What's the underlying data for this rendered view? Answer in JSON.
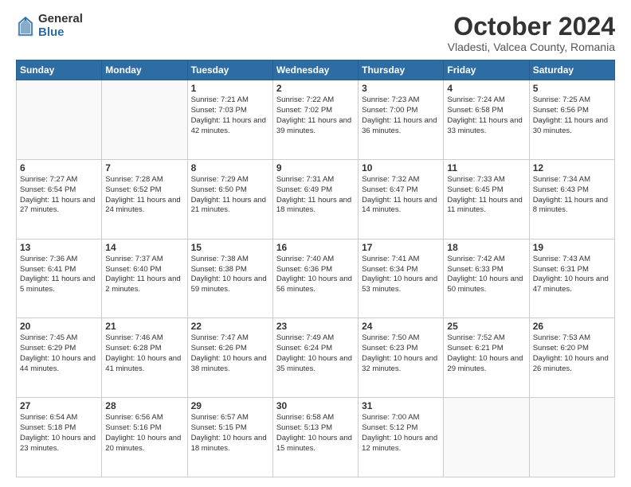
{
  "logo": {
    "general": "General",
    "blue": "Blue"
  },
  "header": {
    "month": "October 2024",
    "location": "Vladesti, Valcea County, Romania"
  },
  "weekdays": [
    "Sunday",
    "Monday",
    "Tuesday",
    "Wednesday",
    "Thursday",
    "Friday",
    "Saturday"
  ],
  "weeks": [
    [
      {
        "day": "",
        "info": ""
      },
      {
        "day": "",
        "info": ""
      },
      {
        "day": "1",
        "info": "Sunrise: 7:21 AM\nSunset: 7:03 PM\nDaylight: 11 hours and 42 minutes."
      },
      {
        "day": "2",
        "info": "Sunrise: 7:22 AM\nSunset: 7:02 PM\nDaylight: 11 hours and 39 minutes."
      },
      {
        "day": "3",
        "info": "Sunrise: 7:23 AM\nSunset: 7:00 PM\nDaylight: 11 hours and 36 minutes."
      },
      {
        "day": "4",
        "info": "Sunrise: 7:24 AM\nSunset: 6:58 PM\nDaylight: 11 hours and 33 minutes."
      },
      {
        "day": "5",
        "info": "Sunrise: 7:25 AM\nSunset: 6:56 PM\nDaylight: 11 hours and 30 minutes."
      }
    ],
    [
      {
        "day": "6",
        "info": "Sunrise: 7:27 AM\nSunset: 6:54 PM\nDaylight: 11 hours and 27 minutes."
      },
      {
        "day": "7",
        "info": "Sunrise: 7:28 AM\nSunset: 6:52 PM\nDaylight: 11 hours and 24 minutes."
      },
      {
        "day": "8",
        "info": "Sunrise: 7:29 AM\nSunset: 6:50 PM\nDaylight: 11 hours and 21 minutes."
      },
      {
        "day": "9",
        "info": "Sunrise: 7:31 AM\nSunset: 6:49 PM\nDaylight: 11 hours and 18 minutes."
      },
      {
        "day": "10",
        "info": "Sunrise: 7:32 AM\nSunset: 6:47 PM\nDaylight: 11 hours and 14 minutes."
      },
      {
        "day": "11",
        "info": "Sunrise: 7:33 AM\nSunset: 6:45 PM\nDaylight: 11 hours and 11 minutes."
      },
      {
        "day": "12",
        "info": "Sunrise: 7:34 AM\nSunset: 6:43 PM\nDaylight: 11 hours and 8 minutes."
      }
    ],
    [
      {
        "day": "13",
        "info": "Sunrise: 7:36 AM\nSunset: 6:41 PM\nDaylight: 11 hours and 5 minutes."
      },
      {
        "day": "14",
        "info": "Sunrise: 7:37 AM\nSunset: 6:40 PM\nDaylight: 11 hours and 2 minutes."
      },
      {
        "day": "15",
        "info": "Sunrise: 7:38 AM\nSunset: 6:38 PM\nDaylight: 10 hours and 59 minutes."
      },
      {
        "day": "16",
        "info": "Sunrise: 7:40 AM\nSunset: 6:36 PM\nDaylight: 10 hours and 56 minutes."
      },
      {
        "day": "17",
        "info": "Sunrise: 7:41 AM\nSunset: 6:34 PM\nDaylight: 10 hours and 53 minutes."
      },
      {
        "day": "18",
        "info": "Sunrise: 7:42 AM\nSunset: 6:33 PM\nDaylight: 10 hours and 50 minutes."
      },
      {
        "day": "19",
        "info": "Sunrise: 7:43 AM\nSunset: 6:31 PM\nDaylight: 10 hours and 47 minutes."
      }
    ],
    [
      {
        "day": "20",
        "info": "Sunrise: 7:45 AM\nSunset: 6:29 PM\nDaylight: 10 hours and 44 minutes."
      },
      {
        "day": "21",
        "info": "Sunrise: 7:46 AM\nSunset: 6:28 PM\nDaylight: 10 hours and 41 minutes."
      },
      {
        "day": "22",
        "info": "Sunrise: 7:47 AM\nSunset: 6:26 PM\nDaylight: 10 hours and 38 minutes."
      },
      {
        "day": "23",
        "info": "Sunrise: 7:49 AM\nSunset: 6:24 PM\nDaylight: 10 hours and 35 minutes."
      },
      {
        "day": "24",
        "info": "Sunrise: 7:50 AM\nSunset: 6:23 PM\nDaylight: 10 hours and 32 minutes."
      },
      {
        "day": "25",
        "info": "Sunrise: 7:52 AM\nSunset: 6:21 PM\nDaylight: 10 hours and 29 minutes."
      },
      {
        "day": "26",
        "info": "Sunrise: 7:53 AM\nSunset: 6:20 PM\nDaylight: 10 hours and 26 minutes."
      }
    ],
    [
      {
        "day": "27",
        "info": "Sunrise: 6:54 AM\nSunset: 5:18 PM\nDaylight: 10 hours and 23 minutes."
      },
      {
        "day": "28",
        "info": "Sunrise: 6:56 AM\nSunset: 5:16 PM\nDaylight: 10 hours and 20 minutes."
      },
      {
        "day": "29",
        "info": "Sunrise: 6:57 AM\nSunset: 5:15 PM\nDaylight: 10 hours and 18 minutes."
      },
      {
        "day": "30",
        "info": "Sunrise: 6:58 AM\nSunset: 5:13 PM\nDaylight: 10 hours and 15 minutes."
      },
      {
        "day": "31",
        "info": "Sunrise: 7:00 AM\nSunset: 5:12 PM\nDaylight: 10 hours and 12 minutes."
      },
      {
        "day": "",
        "info": ""
      },
      {
        "day": "",
        "info": ""
      }
    ]
  ]
}
